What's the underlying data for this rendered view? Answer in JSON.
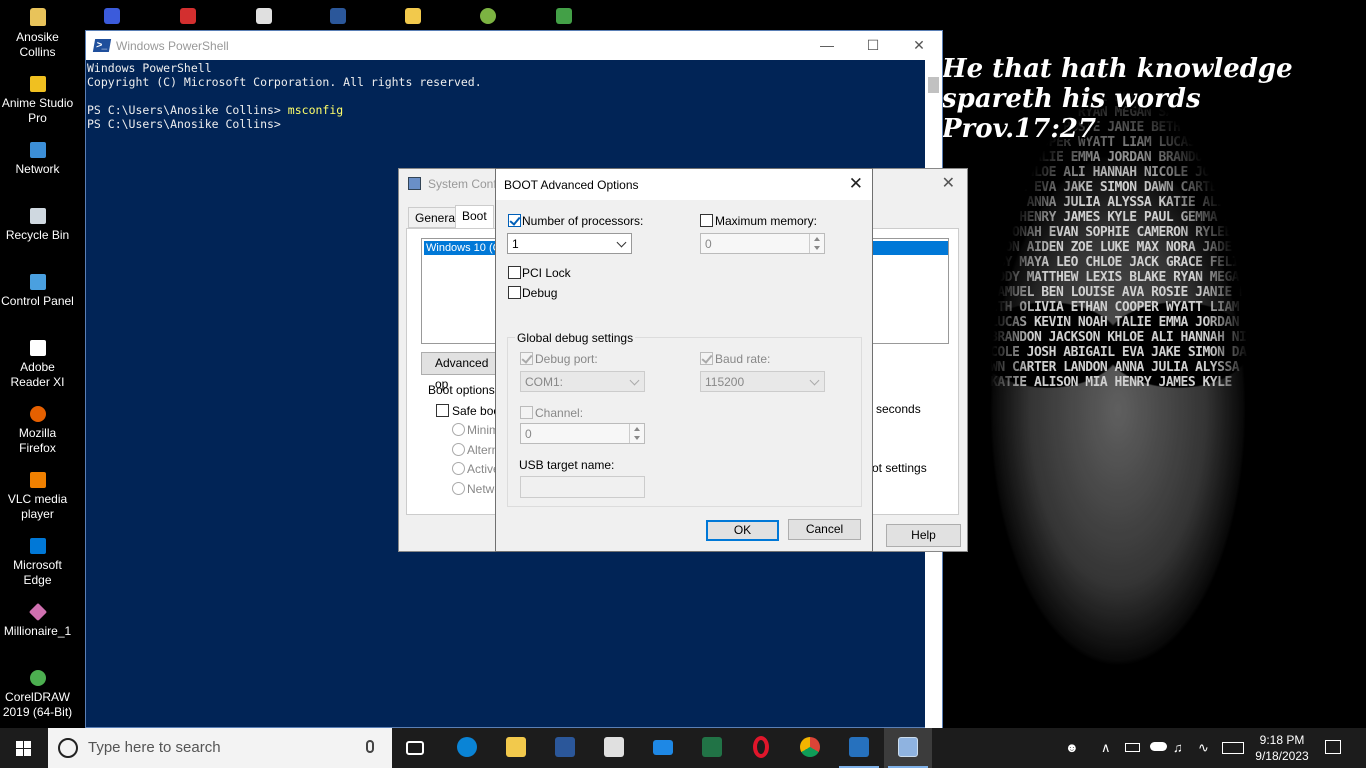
{
  "desktop": {
    "wallpaper_quote": [
      "He that hath knowledge",
      "spareth his words",
      "Prov.17:27"
    ],
    "mask_names": "CHLOE JACK GRACE FELIX ADDY MATTHEW LEXIS BLAKE RYAN MEGAN SAMUEL BEN LOUISE AVA ROSIE JANIE BETH OLIVIA ETHAN COOPER WYATT LIAM LUCAS KEVIN NOAH TALIE EMMA JORDAN BRANDON JACKSON KHLOE ALI HANNAH NICOLE JOSH ABIGAIL EVA JAKE SIMON DAWN CARTER LANDON ANNA JULIA ALYSSA KATIE ALISON MIA HENRY JAMES KYLE PAUL GEMMA ALEX JONAH EVAN SOPHIE CAMERON RYLEE MASON AIDEN ZOE LUKE MAX NORA JADE RUBY MAYA LEO CHLOE JACK GRACE FELIX ADDY MATTHEW LEXIS BLAKE RYAN MEGAN SAMUEL BEN LOUISE AVA ROSIE JANIE BETH OLIVIA ETHAN COOPER WYATT LIAM LUCAS KEVIN NOAH TALIE EMMA JORDAN BRANDON JACKSON KHLOE ALI HANNAH NICOLE JOSH ABIGAIL EVA JAKE SIMON DAWN CARTER LANDON ANNA JULIA ALYSSA KATIE ALISON MIA HENRY JAMES KYLE",
    "icons": [
      {
        "label": "Anosike Collins",
        "icon": "user-folder-icon",
        "color": "#e8c35a"
      },
      {
        "label": "Anime Studio Pro",
        "icon": "anime-studio-icon",
        "color": "#f0c020"
      },
      {
        "label": "Network",
        "icon": "network-icon",
        "color": "#3c8fd8"
      },
      {
        "label": "Recycle Bin",
        "icon": "recycle-bin-icon",
        "color": "#cfd8e0"
      },
      {
        "label": "Control Panel",
        "icon": "control-panel-icon",
        "color": "#4aa0e0"
      },
      {
        "label": "Adobe Reader XI",
        "icon": "adobe-reader-icon",
        "color": "#ffffff"
      },
      {
        "label": "Mozilla Firefox",
        "icon": "firefox-icon",
        "color": "#e66000"
      },
      {
        "label": "VLC media player",
        "icon": "vlc-icon",
        "color": "#f08000"
      },
      {
        "label": "Microsoft Edge",
        "icon": "edge-icon",
        "color": "#0078d7"
      },
      {
        "label": "Millionaire_1",
        "icon": "millionaire-icon",
        "color": "#d070b0"
      },
      {
        "label": "CorelDRAW 2019 (64-Bit)",
        "icon": "coreldraw-icon",
        "color": "#4caf50"
      }
    ],
    "top_row_colors": [
      "#3b5bdb",
      "#d32f2f",
      "#e0e0e0",
      "#2b579a",
      "#f2c94c",
      "#7cb342",
      "#43a047"
    ]
  },
  "powershell": {
    "title": "Windows PowerShell",
    "lines": [
      {
        "text": "Windows PowerShell",
        "cmd": ""
      },
      {
        "text": "Copyright (C) Microsoft Corporation. All rights reserved.",
        "cmd": ""
      },
      {
        "text": "",
        "cmd": ""
      },
      {
        "text": "PS C:\\Users\\Anosike Collins> ",
        "cmd": "msconfig"
      },
      {
        "text": "PS C:\\Users\\Anosike Collins> ",
        "cmd": ""
      }
    ],
    "bg_color": "#012456"
  },
  "sysconfig": {
    "title": "System Conf",
    "tabs": [
      "General",
      "Boot"
    ],
    "os_entry": "Windows 10 (C",
    "advanced_button": "Advanced op",
    "boot_options_label": "Boot options",
    "safe_boot": "Safe boo",
    "radio_options": [
      "Minima",
      "Altern",
      "Active",
      "Netwo"
    ],
    "seconds_label": "seconds",
    "boot_settings_label": "ot settings",
    "help_button": "Help"
  },
  "boot_advanced": {
    "title": "BOOT Advanced Options",
    "num_processors": {
      "label": "Number of processors:",
      "checked": true,
      "value": "1"
    },
    "max_memory": {
      "label": "Maximum memory:",
      "checked": false,
      "value": "0"
    },
    "pci_lock": {
      "label": "PCI Lock",
      "checked": false
    },
    "debug": {
      "label": "Debug",
      "checked": false
    },
    "global_debug": {
      "label": "Global debug settings",
      "debug_port": {
        "label": "Debug port:",
        "checked": true,
        "value": "COM1:"
      },
      "baud_rate": {
        "label": "Baud rate:",
        "checked": true,
        "value": "115200"
      },
      "channel": {
        "label": "Channel:",
        "checked": false,
        "value": "0"
      },
      "usb_target": {
        "label": "USB target name:",
        "value": ""
      }
    },
    "ok_button": "OK",
    "cancel_button": "Cancel"
  },
  "taskbar": {
    "search_placeholder": "Type here to search",
    "apps": [
      {
        "name": "task-view",
        "color": "#ffffff"
      },
      {
        "name": "edge",
        "color": "#0a84d6"
      },
      {
        "name": "file-explorer",
        "color": "#f2c94c"
      },
      {
        "name": "word",
        "color": "#2b579a"
      },
      {
        "name": "store",
        "color": "#e0e0e0"
      },
      {
        "name": "mail",
        "color": "#1e88e5"
      },
      {
        "name": "excel",
        "color": "#217346"
      },
      {
        "name": "opera",
        "color": "#e0162b"
      },
      {
        "name": "chrome",
        "color": "#e8b400"
      },
      {
        "name": "powershell",
        "color": "#2671be"
      },
      {
        "name": "system-config",
        "color": "#8fb3e0"
      }
    ],
    "time": "9:18 PM",
    "date": "9/18/2023"
  }
}
